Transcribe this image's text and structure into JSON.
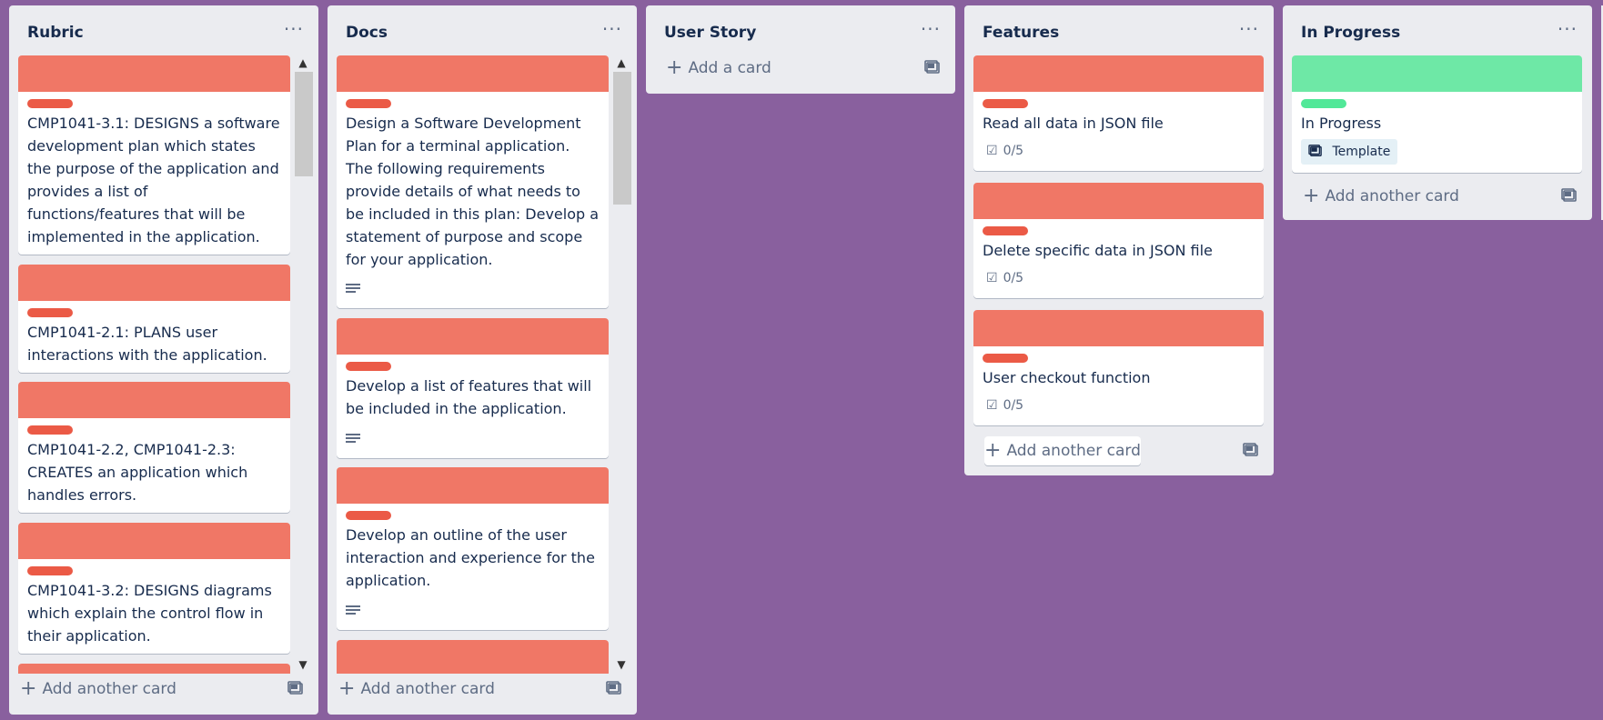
{
  "colors": {
    "board_bg": "#89609E",
    "list_bg": "#EBECF0",
    "cover_red": "#F07766",
    "label_red": "#EB5A46",
    "cover_green": "#6EE8A6",
    "label_green": "#51E898",
    "badge_bg": "#E4F0F6"
  },
  "icons": {
    "list_menu": "ellipsis-icon",
    "add": "plus-icon",
    "template": "template-icon",
    "description": "description-icon",
    "checklist": "checklist-icon"
  },
  "lists": [
    {
      "title": "Rubric",
      "menu": "···",
      "add_label": "Add another card",
      "cards": [
        {
          "text": "CMP1041-3.1: DESIGNS a software development plan which states the purpose of the application and provides a list of functions/features that will be implemented in the application."
        },
        {
          "text": "CMP1041-2.1: PLANS user interactions with the application."
        },
        {
          "text": "CMP1041-2.2, CMP1041-2.3: CREATES an application which handles errors."
        },
        {
          "text": "CMP1041-3.2: DESIGNS diagrams which explain the control flow in their application."
        }
      ]
    },
    {
      "title": "Docs",
      "menu": "···",
      "add_label": "Add another card",
      "cards": [
        {
          "text": "Design a Software Development Plan for a terminal application. The following requirements provide details of what needs to be included in this plan: Develop a statement of purpose and scope for your application."
        },
        {
          "text": "Develop a list of features that will be included in the application."
        },
        {
          "text": "Develop an outline of the user interaction and experience for the application."
        }
      ]
    },
    {
      "title": "User Story",
      "menu": "···",
      "add_label": "Add a card",
      "cards": []
    },
    {
      "title": "Features",
      "menu": "···",
      "add_label": "Add another card",
      "cards": [
        {
          "text": "Read all data in JSON file",
          "checklist": "0/5"
        },
        {
          "text": "Delete specific data in JSON file",
          "checklist": "0/5"
        },
        {
          "text": "User checkout function",
          "checklist": "0/5"
        }
      ]
    },
    {
      "title": "In Progress",
      "menu": "···",
      "add_label": "Add another card",
      "cards": [
        {
          "text": "In Progress",
          "badge": "Template"
        }
      ]
    }
  ]
}
